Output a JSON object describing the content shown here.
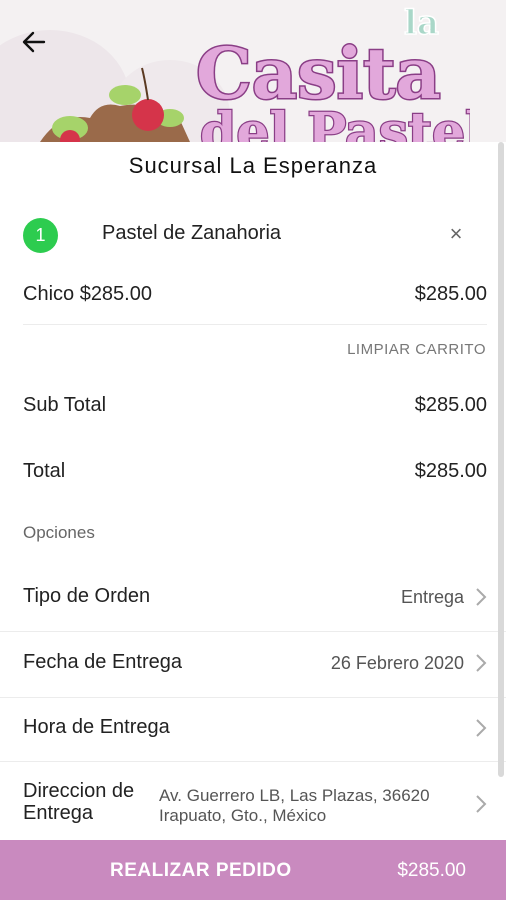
{
  "header": {
    "logo_line1": "la",
    "logo_line2": "Casita",
    "logo_line3": "del Pastel",
    "colors": {
      "logo_pink": "#d79bcf",
      "logo_outline": "#8a3e86",
      "logo_green": "#a9d7c8",
      "cherry_red": "#d5344a"
    }
  },
  "store": {
    "name": "Sucursal La Esperanza"
  },
  "cart": {
    "items": [
      {
        "quantity": "1",
        "name": "Pastel de Zanahoria",
        "size_price": "Chico $285.00",
        "line_total": "$285.00"
      }
    ],
    "clear_label": "LIMPIAR CARRITO"
  },
  "totals": {
    "subtotal_label": "Sub Total",
    "subtotal_value": "$285.00",
    "total_label": "Total",
    "total_value": "$285.00"
  },
  "options": {
    "section_label": "Opciones",
    "order_type_label": "Tipo de Orden",
    "order_type_value": "Entrega",
    "delivery_date_label": "Fecha de Entrega",
    "delivery_date_value": "26 Febrero 2020",
    "delivery_time_label": "Hora de Entrega",
    "delivery_time_value": "",
    "address_label": "Direccion de Entrega",
    "address_value": "Av. Guerrero LB, Las Plazas, 36620 Irapuato, Gto., México"
  },
  "footer": {
    "order_button_label": "REALIZAR PEDIDO",
    "order_total": "$285.00",
    "bar_color": "#c98abf"
  },
  "icons": {
    "back": "arrow-left-icon",
    "remove": "close-icon",
    "chevron": "chevron-right-icon"
  }
}
